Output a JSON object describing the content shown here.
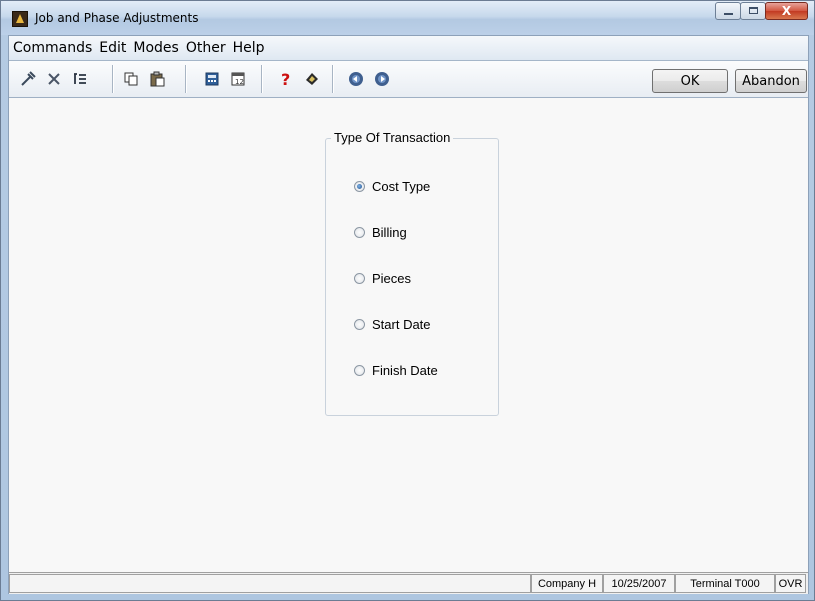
{
  "window": {
    "title": "Job and Phase Adjustments",
    "caption_close": "X"
  },
  "menu": [
    "Commands",
    "Edit",
    "Modes",
    "Other",
    "Help"
  ],
  "toolbar": {
    "icons": [
      "tools-icon",
      "delete-icon",
      "list-icon",
      "copy-icon",
      "paste-icon",
      "calculator-icon",
      "calendar-icon",
      "help-icon",
      "book-icon",
      "back-icon",
      "forward-icon"
    ],
    "ok_label": "OK",
    "abandon_label": "Abandon"
  },
  "transaction": {
    "legend": "Type Of Transaction",
    "options": [
      "Cost Type",
      "Billing",
      "Pieces",
      "Start Date",
      "Finish Date"
    ],
    "selected": "Cost Type"
  },
  "status": {
    "cells": [
      "",
      "Company H",
      "10/25/2007",
      "Terminal T000",
      "OVR"
    ]
  }
}
